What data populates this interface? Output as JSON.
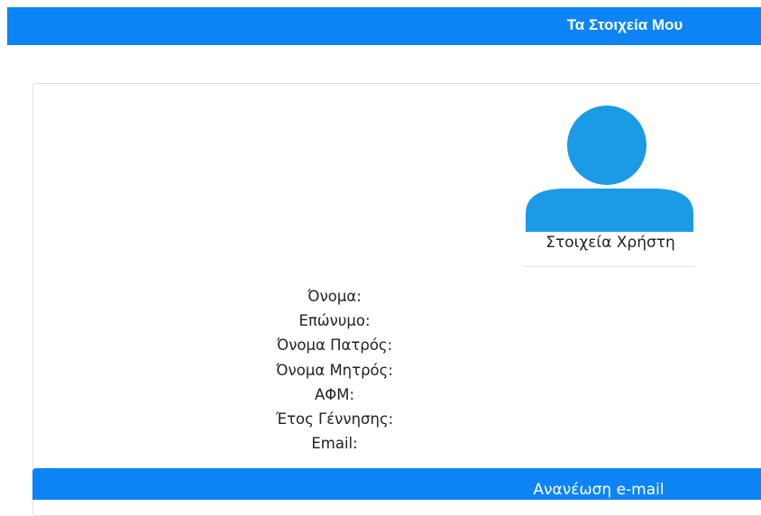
{
  "header": {
    "title": "Τα Στοιχεία Μου"
  },
  "profile": {
    "avatar_icon": "user-silhouette-icon",
    "avatar_color": "#1b9be6",
    "caption": "Στοιχεία Χρήστη"
  },
  "fields": [
    {
      "label": "Όνομα:"
    },
    {
      "label": "Επώνυμο:"
    },
    {
      "label": "Όνομα Πατρός:"
    },
    {
      "label": "Όνομα Μητρός:"
    },
    {
      "label": "ΑΦΜ:"
    },
    {
      "label": "Έτος Γέννησης:"
    },
    {
      "label": "Email:"
    }
  ],
  "actions": {
    "update_email_label": "Ανανέωση e-mail"
  },
  "colors": {
    "primary": "#0d84f5",
    "avatar": "#1b9be6"
  }
}
